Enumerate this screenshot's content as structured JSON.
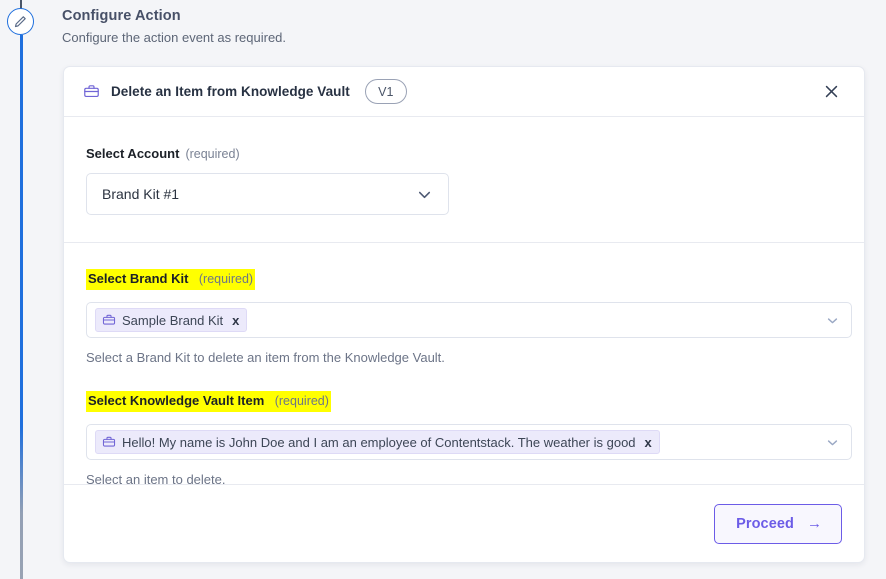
{
  "page": {
    "title": "Configure Action",
    "subtitle": "Configure the action event as required."
  },
  "rail": {
    "node_icon": "pencil-icon"
  },
  "card": {
    "icon": "briefcase-icon",
    "title": "Delete an Item from Knowledge Vault",
    "version_badge": "V1",
    "close_icon": "close-icon"
  },
  "account_section": {
    "label": "Select Account",
    "required_text": "(required)",
    "selected_value": "Brand Kit #1",
    "caret_icon": "chevron-down-icon"
  },
  "brand_kit_section": {
    "label": "Select Brand Kit",
    "required_text": "(required)",
    "highlighted": true,
    "chip": {
      "icon": "briefcase-icon",
      "text": "Sample Brand Kit",
      "remove_icon": "x"
    },
    "caret_icon": "chevron-down-icon",
    "help_text": "Select a Brand Kit to delete an item from the Knowledge Vault."
  },
  "vault_item_section": {
    "label": "Select Knowledge Vault Item",
    "required_text": "(required)",
    "highlighted": true,
    "chip": {
      "icon": "briefcase-icon",
      "text": "Hello! My name is John Doe and I am an employee of Contentstack. The weather is good",
      "remove_icon": "x"
    },
    "caret_icon": "chevron-down-icon",
    "help_text": "Select an item to delete."
  },
  "footer": {
    "proceed_label": "Proceed",
    "proceed_arrow": "→"
  },
  "colors": {
    "accent_purple": "#6c5ce7",
    "timeline_blue": "#1f6fdd",
    "highlight_yellow": "#ffff00",
    "page_background": "#f4f5f8"
  }
}
